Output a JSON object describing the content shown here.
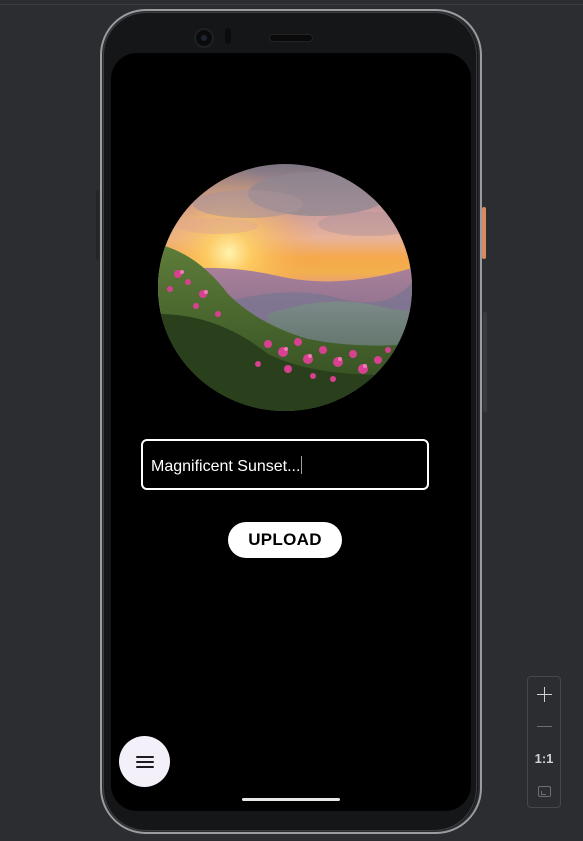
{
  "screen": {
    "image_description_name": "sunset-photo",
    "input": {
      "value": "Magnificent Sunset..."
    },
    "upload_button": {
      "label": "UPLOAD"
    },
    "fab": {
      "icon": "menu-icon"
    }
  },
  "zoom_controls": {
    "zoom_in_icon": "plus-icon",
    "zoom_out_icon": "minus-icon",
    "actual_size_label": "1:1",
    "fit_icon": "fit-screen-icon"
  },
  "colors": {
    "screen_background": "#000000",
    "button_background": "#ffffff",
    "fab_background": "#f4f0fa",
    "power_button": "#d98a5e",
    "ide_background": "#2b2d31"
  }
}
